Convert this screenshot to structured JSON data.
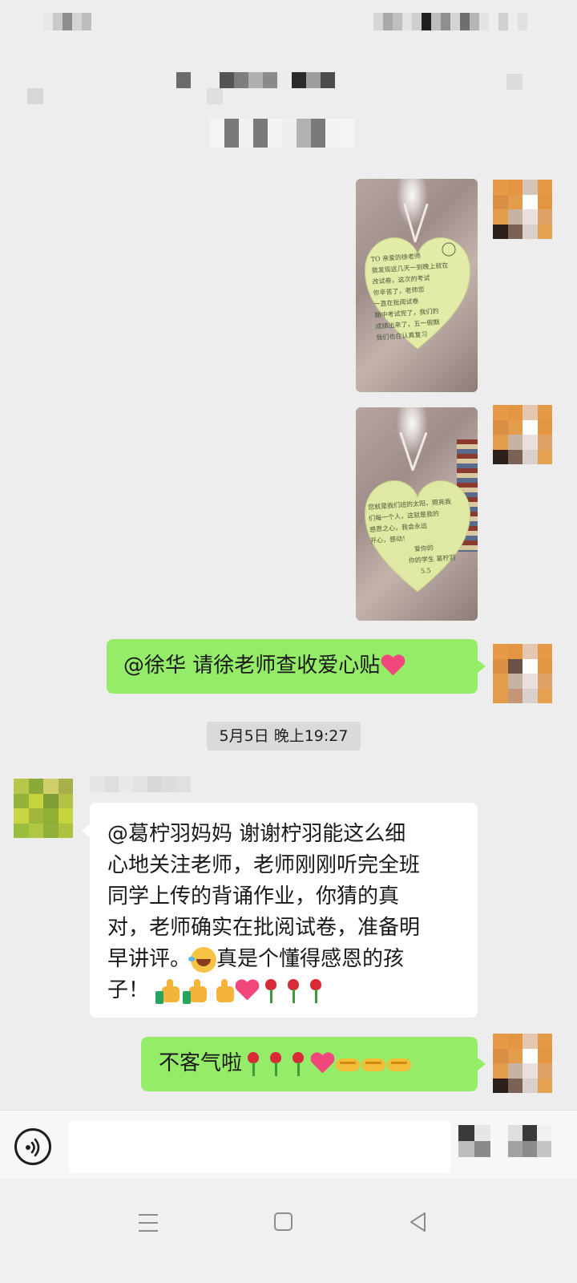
{
  "statusbar": {
    "left_blur_colors": [
      "#e7e7e7",
      "#c9c9c9",
      "#8d8d8d",
      "#d4d4d4",
      "#bdbdbd"
    ],
    "right_blur_colors": [
      "#d6d6d6",
      "#a9a9a9",
      "#bfbfbf",
      "#1f1f1f",
      "#8f8f8f",
      "#d4d4d4",
      "#6f6f6f",
      "#e3e3e3"
    ]
  },
  "header": {
    "title_blur_colors": [
      "#6b6b6b",
      "#ededed",
      "#545454",
      "#7d7d7d",
      "#b0b0b0",
      "#8a8a8a",
      "#2a2a2a",
      "#9e9e9e",
      "#4c4c4c"
    ]
  },
  "messages": [
    {
      "id": "msg-photo-1",
      "type": "image",
      "side": "right",
      "alt": "heart-shaped card photo 1",
      "card_lines": [
        "TO 亲爱的徐老师",
        "我发现这几天一到晚上就在",
        "改试卷，这次的考试",
        "你辛苦了，老师您",
        "一直在批阅试卷",
        "期中考试完了，我们的",
        "成绩出来了，五一假期",
        "我们也在认真复习",
        "徐老"
      ]
    },
    {
      "id": "msg-photo-2",
      "type": "image",
      "side": "right",
      "alt": "heart-shaped card photo 2",
      "card_lines": [
        "您就是我们班的太阳，照亮我",
        "们每一个人，这就是我的",
        "感恩之心，我会永远",
        "开心，感动！",
        "",
        "爱你的",
        "你的学生 葛柠羽",
        "5.5"
      ]
    },
    {
      "id": "msg-text-1",
      "type": "text",
      "side": "right",
      "text": "@徐华  请徐老师查收爱心贴"
    },
    {
      "id": "time-1",
      "type": "timestamp",
      "text": "5月5日 晚上19:27"
    },
    {
      "id": "msg-text-2",
      "type": "text",
      "side": "left",
      "lines": [
        "@葛柠羽妈妈  谢谢柠羽能这么细",
        "心地关注老师，老师刚刚听完全班",
        "同学上传的背诵作业，你猜的真",
        "对，老师确实在批阅试卷，准备明",
        "早讲评。",
        "真是个懂得感恩的孩",
        "子！"
      ]
    },
    {
      "id": "msg-text-3",
      "type": "text",
      "side": "right",
      "text": "不客气啦"
    }
  ],
  "input": {
    "value": "",
    "placeholder": ""
  },
  "avatars": {
    "self_colors": [
      "#e69a48",
      "#e49541",
      "#d5c4b8",
      "#ffffff",
      "#d99046",
      "#e39b4c",
      "#e8e0dc",
      "#c9c9c9",
      "#7a6256",
      "#2b1f1a",
      "#c7b2a2",
      "#e0a266",
      "#e9a451",
      "#e0a05b",
      "#e7a35d",
      "#e5a052"
    ],
    "other_colors": [
      "#b8c64a",
      "#8aa938",
      "#cfcf6b",
      "#a7b04a",
      "#97b23a",
      "#c4d33e",
      "#7e9f37",
      "#b3c244",
      "#c8d641",
      "#a1b63b",
      "#8fb035",
      "#c5d43f",
      "#9bbd3e",
      "#b0c645",
      "#90b03a",
      "#aec23f"
    ]
  },
  "colors": {
    "background": "#ededed",
    "bubble_self": "#95ec69",
    "bubble_other": "#ffffff",
    "timestamp_bg": "#dadada"
  }
}
